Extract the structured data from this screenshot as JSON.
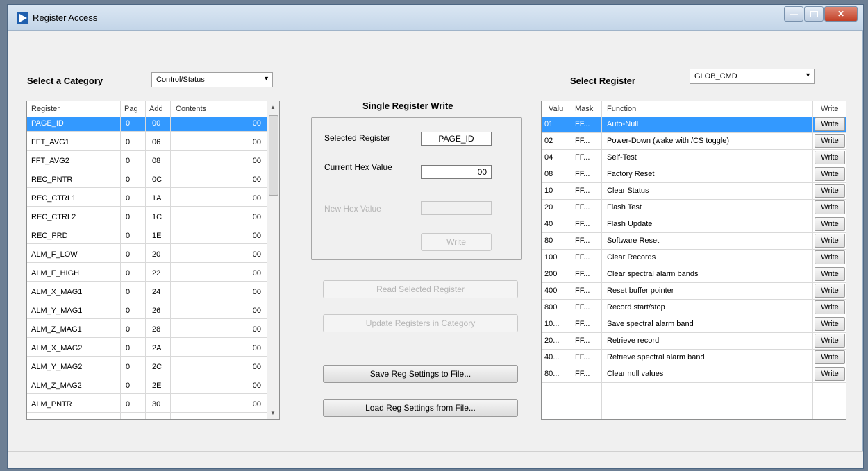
{
  "window": {
    "title": "Register Access"
  },
  "category": {
    "label": "Select a Category",
    "value": "Control/Status"
  },
  "register_select": {
    "label": "Select Register",
    "value": "GLOB_CMD"
  },
  "left_table": {
    "headers": [
      "Register",
      "Pag",
      "Add",
      "Contents"
    ],
    "rows": [
      {
        "reg": "PAGE_ID",
        "pag": "0",
        "add": "00",
        "val": "00"
      },
      {
        "reg": "FFT_AVG1",
        "pag": "0",
        "add": "06",
        "val": "00"
      },
      {
        "reg": "FFT_AVG2",
        "pag": "0",
        "add": "08",
        "val": "00"
      },
      {
        "reg": "REC_PNTR",
        "pag": "0",
        "add": "0C",
        "val": "00"
      },
      {
        "reg": "REC_CTRL1",
        "pag": "0",
        "add": "1A",
        "val": "00"
      },
      {
        "reg": "REC_CTRL2",
        "pag": "0",
        "add": "1C",
        "val": "00"
      },
      {
        "reg": "REC_PRD",
        "pag": "0",
        "add": "1E",
        "val": "00"
      },
      {
        "reg": "ALM_F_LOW",
        "pag": "0",
        "add": "20",
        "val": "00"
      },
      {
        "reg": "ALM_F_HIGH",
        "pag": "0",
        "add": "22",
        "val": "00"
      },
      {
        "reg": "ALM_X_MAG1",
        "pag": "0",
        "add": "24",
        "val": "00"
      },
      {
        "reg": "ALM_Y_MAG1",
        "pag": "0",
        "add": "26",
        "val": "00"
      },
      {
        "reg": "ALM_Z_MAG1",
        "pag": "0",
        "add": "28",
        "val": "00"
      },
      {
        "reg": "ALM_X_MAG2",
        "pag": "0",
        "add": "2A",
        "val": "00"
      },
      {
        "reg": "ALM_Y_MAG2",
        "pag": "0",
        "add": "2C",
        "val": "00"
      },
      {
        "reg": "ALM_Z_MAG2",
        "pag": "0",
        "add": "2E",
        "val": "00"
      },
      {
        "reg": "ALM_PNTR",
        "pag": "0",
        "add": "30",
        "val": "00"
      }
    ]
  },
  "single_write": {
    "title": "Single Register Write",
    "selected_label": "Selected Register",
    "selected_value": "PAGE_ID",
    "current_label": "Current Hex Value",
    "current_value": "00",
    "new_label": "New Hex Value",
    "new_value": "",
    "write_label": "Write"
  },
  "buttons": {
    "read_selected": "Read Selected Register",
    "update_category": "Update Registers in Category",
    "save": "Save Reg Settings to File...",
    "load": "Load Reg Settings from File..."
  },
  "right_table": {
    "headers": [
      "Valu",
      "Mask",
      "Function",
      "Write"
    ],
    "write_label": "Write",
    "rows": [
      {
        "v": "01",
        "m": "FF...",
        "f": "Auto-Null"
      },
      {
        "v": "02",
        "m": "FF...",
        "f": "Power-Down (wake with /CS toggle)"
      },
      {
        "v": "04",
        "m": "FF...",
        "f": "Self-Test"
      },
      {
        "v": "08",
        "m": "FF...",
        "f": "Factory Reset"
      },
      {
        "v": "10",
        "m": "FF...",
        "f": "Clear Status"
      },
      {
        "v": "20",
        "m": "FF...",
        "f": "Flash Test"
      },
      {
        "v": "40",
        "m": "FF...",
        "f": "Flash Update"
      },
      {
        "v": "80",
        "m": "FF...",
        "f": "Software Reset"
      },
      {
        "v": "100",
        "m": "FF...",
        "f": "Clear Records"
      },
      {
        "v": "200",
        "m": "FF...",
        "f": "Clear spectral alarm bands"
      },
      {
        "v": "400",
        "m": "FF...",
        "f": "Reset buffer pointer"
      },
      {
        "v": "800",
        "m": "FF...",
        "f": "Record start/stop"
      },
      {
        "v": "10...",
        "m": "FF...",
        "f": "Save spectral alarm band"
      },
      {
        "v": "20...",
        "m": "FF...",
        "f": "Retrieve record"
      },
      {
        "v": "40...",
        "m": "FF...",
        "f": "Retrieve spectral alarm band"
      },
      {
        "v": "80...",
        "m": "FF...",
        "f": "Clear null values"
      }
    ]
  }
}
